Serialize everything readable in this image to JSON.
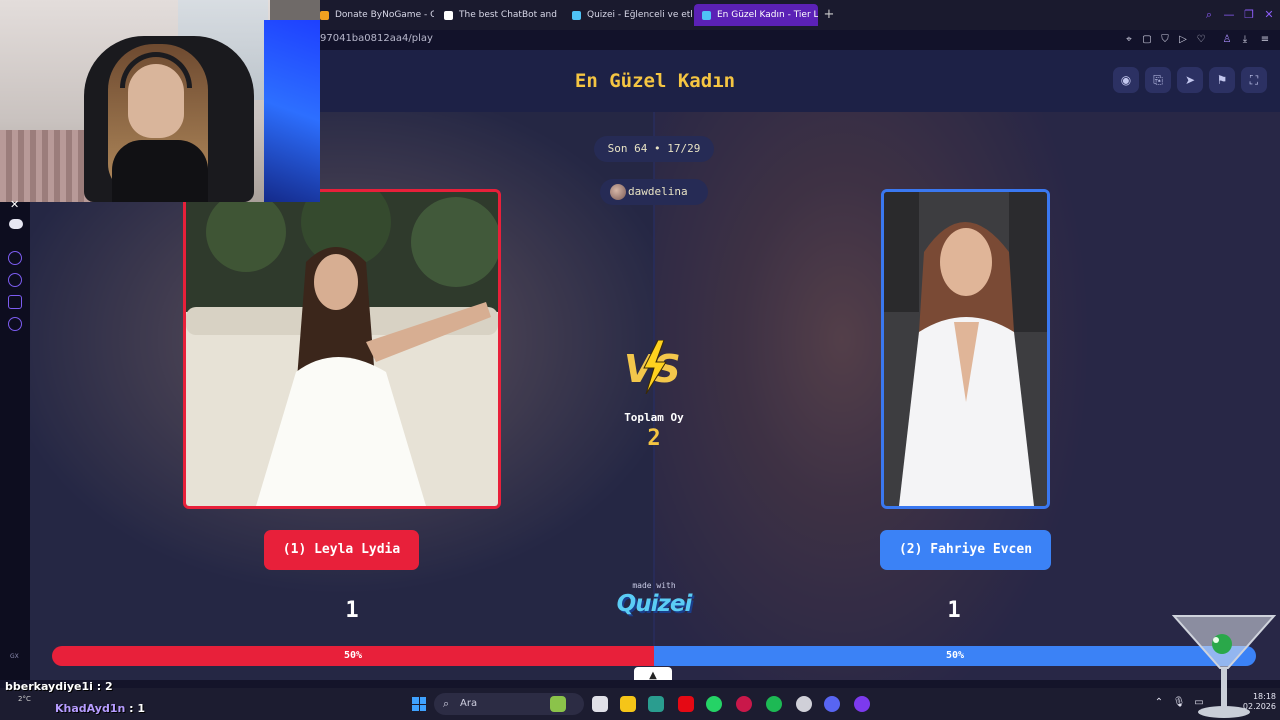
{
  "browser": {
    "tabs": [
      {
        "label": "Donate ByNoGame - Gele",
        "active": false
      },
      {
        "label": "The best ChatBot and Wi",
        "active": false
      },
      {
        "label": "Quizei - Eğlenceli ve etkile",
        "active": false
      },
      {
        "label": "En Güzel Kadın - Tier List,",
        "active": true
      }
    ],
    "url": "97041ba0812aa4/play"
  },
  "quiz": {
    "title": "En Güzel Kadın",
    "round": "Son 64 • 17/29",
    "creator": "dawdelina",
    "total_label": "Toplam Oy",
    "total_votes": "2",
    "left": {
      "label": "(1) Leyla Lydia",
      "votes": "1",
      "percent_label": "50%",
      "share": 0.5
    },
    "right": {
      "label": "(2) Fahriye Evcen",
      "votes": "1",
      "percent_label": "50%",
      "share": 0.5
    },
    "made_with": "made with",
    "brand": "Quizei",
    "header_icons": [
      "eye-icon",
      "share-icon",
      "send-icon",
      "flag-icon",
      "fullscreen-icon"
    ]
  },
  "overlay": {
    "chat": [
      {
        "user": "bberkaydiye1i",
        "value": ": 2"
      },
      {
        "user": "KhadAyd1n",
        "value": ": 1"
      }
    ],
    "weather": "2°C"
  },
  "taskbar": {
    "search_placeholder": "Ara",
    "time": "18:18",
    "date": "02.2026"
  },
  "colors": {
    "accent_gold": "#f5c542",
    "left_red": "#e8203a",
    "right_blue": "#3b82f6",
    "header_bg": "#1d2146"
  }
}
